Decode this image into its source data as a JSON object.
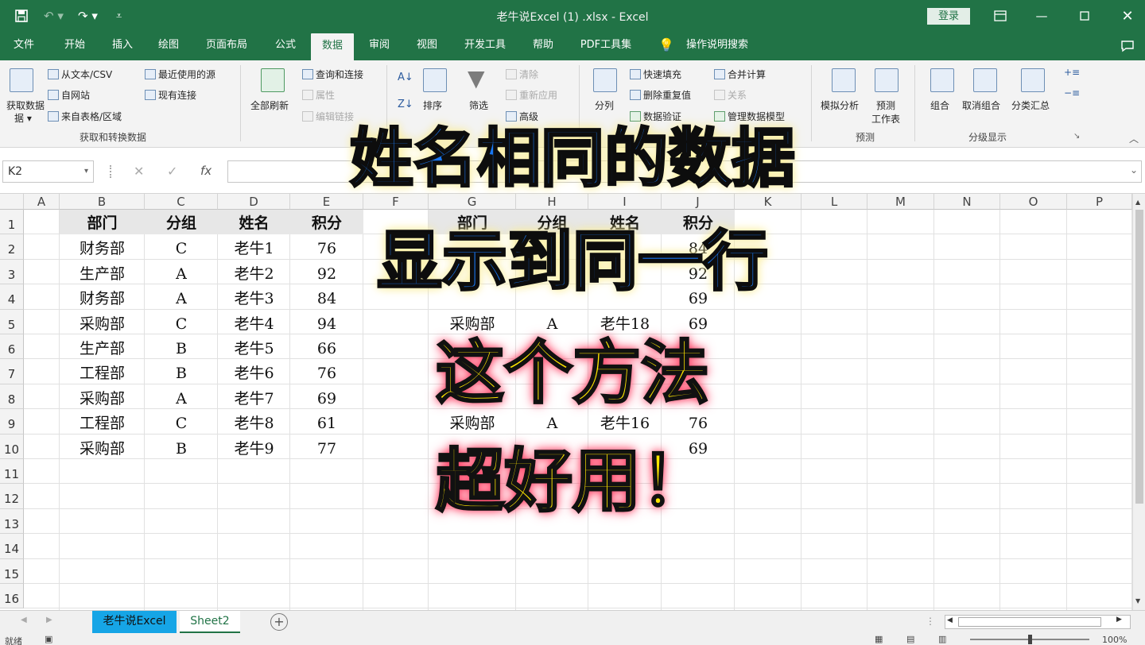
{
  "app": {
    "window_title": "老牛说Excel  (1) .xlsx  -  Excel",
    "login_label": "登录"
  },
  "tabs": [
    "文件",
    "开始",
    "插入",
    "绘图",
    "页面布局",
    "公式",
    "数据",
    "审阅",
    "视图",
    "开发工具",
    "帮助",
    "PDF工具集",
    "操作说明搜索"
  ],
  "active_tab": "数据",
  "ribbon": {
    "get_data": "获取数据",
    "from_text": "从文本/CSV",
    "from_web": "自网站",
    "from_table": "来自表格/区域",
    "recent_sources": "最近使用的源",
    "existing_conn": "现有连接",
    "group_get": "获取和转换数据",
    "refresh_all": "全部刷新",
    "queries_conn": "查询和连接",
    "properties": "属性",
    "edit_links": "编辑链接",
    "sort": "排序",
    "filter": "筛选",
    "clear": "清除",
    "reapply": "重新应用",
    "advanced": "高级",
    "text_to_cols": "分列",
    "flash_fill": "快速填充",
    "remove_dup": "删除重复值",
    "data_valid": "数据验证",
    "consolidate": "合并计算",
    "relations": "关系",
    "manage_model": "管理数据模型",
    "whatif": "模拟分析",
    "forecast": "预测",
    "forecast_sheet": "工作表",
    "group_forecast": "预测",
    "group": "组合",
    "ungroup": "取消组合",
    "subtotal": "分类汇总",
    "group_outline": "分级显示"
  },
  "formula_bar": {
    "name_box": "K2",
    "fx": "fx"
  },
  "columns": [
    "A",
    "B",
    "C",
    "D",
    "E",
    "F",
    "G",
    "H",
    "I",
    "J",
    "K",
    "L",
    "M",
    "N",
    "O",
    "P"
  ],
  "rows": [
    "1",
    "2",
    "3",
    "4",
    "5",
    "6",
    "7",
    "8",
    "9",
    "10",
    "11",
    "12",
    "13",
    "14",
    "15",
    "16"
  ],
  "table_left": {
    "headers": [
      "部门",
      "分组",
      "姓名",
      "积分"
    ],
    "rows": [
      [
        "财务部",
        "C",
        "老牛1",
        "76"
      ],
      [
        "生产部",
        "A",
        "老牛2",
        "92"
      ],
      [
        "财务部",
        "A",
        "老牛3",
        "84"
      ],
      [
        "采购部",
        "C",
        "老牛4",
        "94"
      ],
      [
        "生产部",
        "B",
        "老牛5",
        "66"
      ],
      [
        "工程部",
        "B",
        "老牛6",
        "76"
      ],
      [
        "采购部",
        "A",
        "老牛7",
        "69"
      ],
      [
        "工程部",
        "C",
        "老牛8",
        "61"
      ],
      [
        "采购部",
        "B",
        "老牛9",
        "77"
      ]
    ]
  },
  "table_right": {
    "headers": [
      "部门",
      "分组",
      "姓名",
      "积分"
    ],
    "rows": [
      [
        "",
        "",
        "",
        "84"
      ],
      [
        "",
        "",
        "",
        "92"
      ],
      [
        "",
        "",
        "",
        "69"
      ],
      [
        "采购部",
        "A",
        "老牛18",
        "69"
      ],
      [
        "",
        "",
        "",
        ""
      ],
      [
        "",
        "",
        "",
        ""
      ],
      [
        "",
        "",
        "",
        ""
      ],
      [
        "采购部",
        "A",
        "老牛16",
        "76"
      ],
      [
        "",
        "",
        "",
        "69"
      ]
    ]
  },
  "overlay": {
    "line1": "姓名相同的数据",
    "line2": "显示到同一行",
    "line3": "这个方法",
    "line4": "超好用！"
  },
  "sheets": [
    "老牛说Excel",
    "Sheet2"
  ],
  "active_sheet": "老牛说Excel",
  "status": {
    "ready": "就绪",
    "zoom": "100%"
  },
  "colors": {
    "excel_green": "#217346",
    "overlay_blue": "#1877f2",
    "overlay_yellow": "#ffe600",
    "sheet_tab_active": "#16a5e6"
  }
}
